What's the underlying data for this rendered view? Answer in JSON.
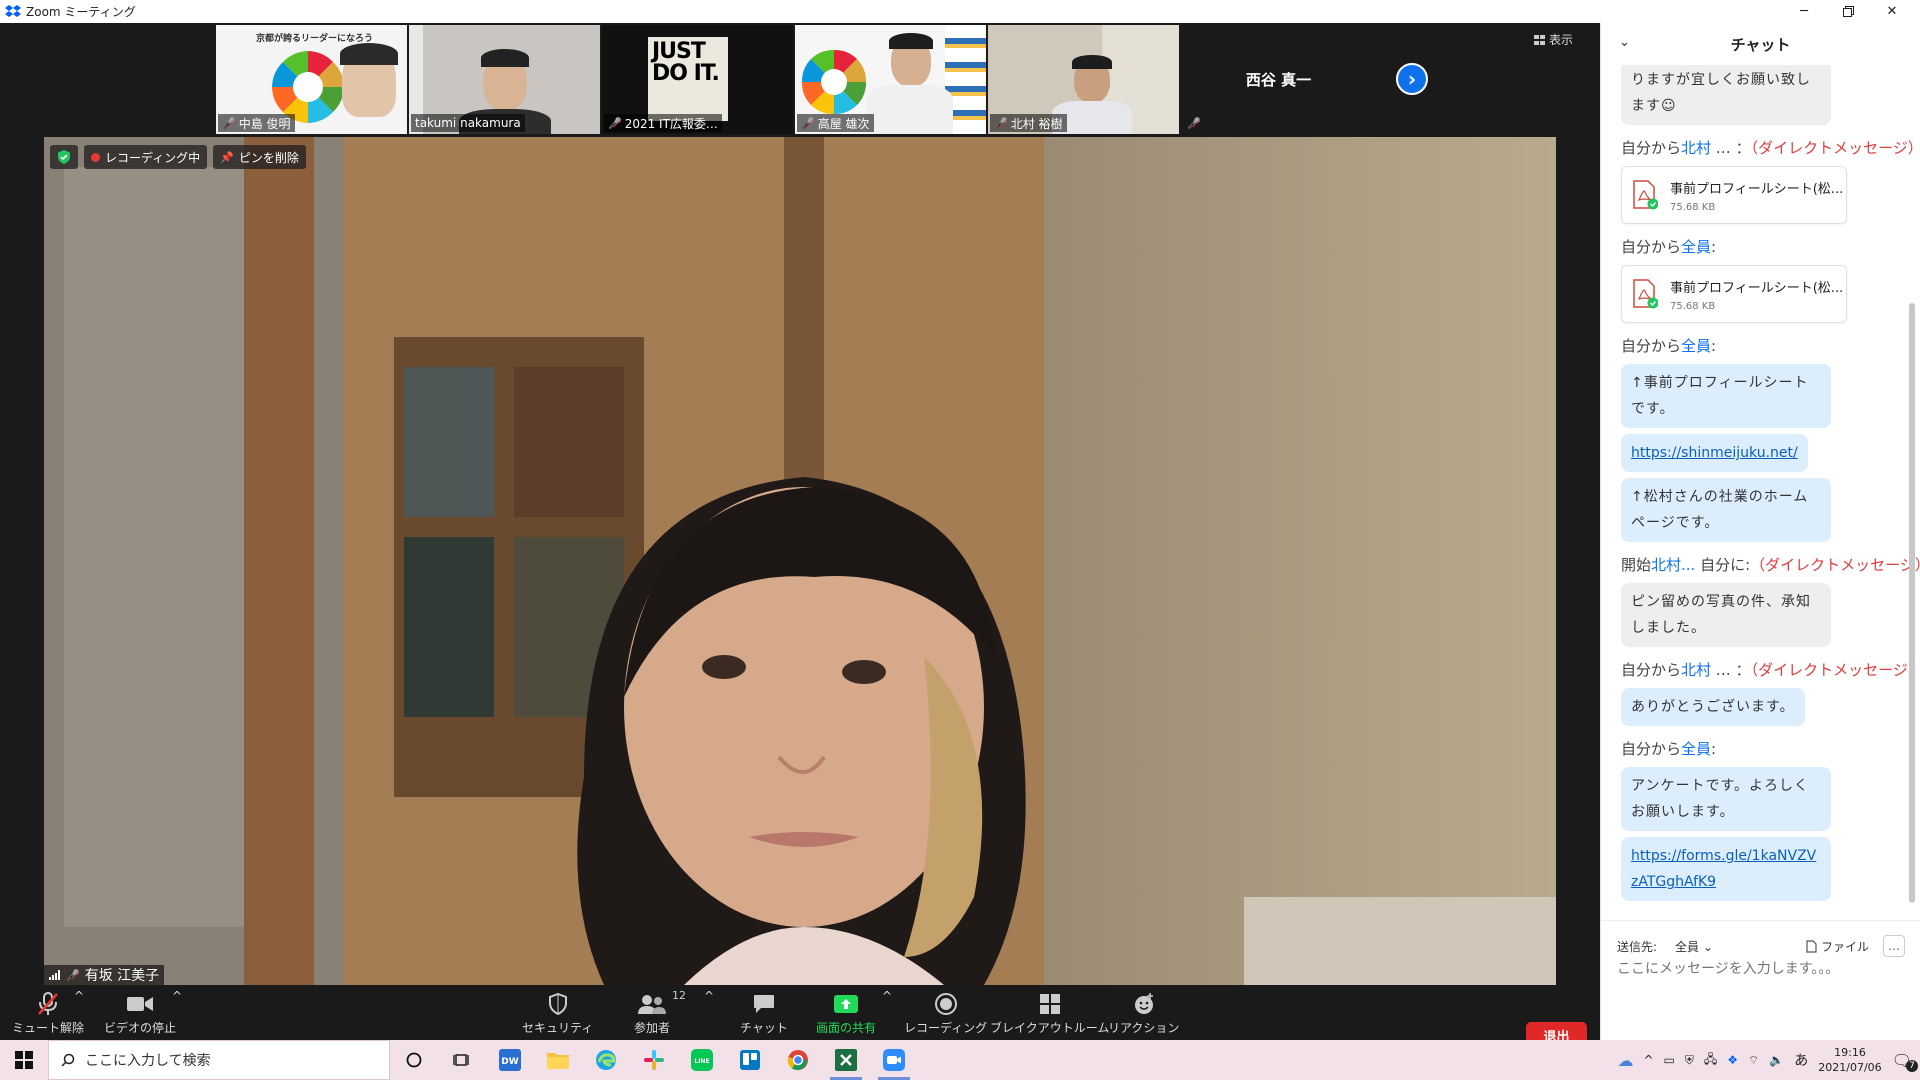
{
  "window": {
    "title": "Zoom ミーティング",
    "controls": [
      "minimize",
      "restore",
      "close"
    ]
  },
  "strip": {
    "participants": [
      {
        "name": "中島 俊明",
        "muted": true,
        "slide_title": "京都が誇るリーダーになろう"
      },
      {
        "name": "takumi nakamura",
        "muted": false
      },
      {
        "name": "2021 IT広報委…",
        "muted": true,
        "poster_text": "JUST DO IT."
      },
      {
        "name": "高屋 雄次",
        "muted": true
      },
      {
        "name": "北村 裕樹",
        "muted": true
      }
    ],
    "no_video_name": "西谷 真一",
    "view_label": "表示"
  },
  "main_video": {
    "recording_label": "レコーディング中",
    "unpin_label": "ピンを削除",
    "speaker_name": "有坂 江美子"
  },
  "toolbar": {
    "unmute": "ミュート解除",
    "stop_video": "ビデオの停止",
    "security": "セキュリティ",
    "participants": "参加者",
    "participants_count": "12",
    "chat": "チャット",
    "share": "画面の共有",
    "record": "レコーディング",
    "breakout": "ブレイクアウトルーム",
    "reactions": "リアクション",
    "leave": "退出",
    "share_color": "#23d959",
    "leave_color": "#e02828"
  },
  "chat": {
    "title": "チャット",
    "partial_top": "りますが宜しくお願い致します☺",
    "m1": {
      "from": "自分から",
      "who": "北村",
      "rest": " … ：",
      "dm": "（ダイレクトメッセージ）"
    },
    "file1": {
      "name": "事前プロフィールシート(松...",
      "size": "75.68 KB"
    },
    "m2": {
      "from": "自分から",
      "who": "全員",
      "rest": ":"
    },
    "file2": {
      "name": "事前プロフィールシート(松...",
      "size": "75.68 KB"
    },
    "m3": {
      "from": "自分から",
      "who": "全員",
      "rest": ":"
    },
    "m3_text": "↑事前プロフィールシートです。",
    "m3_link": "https://shinmeijuku.net/",
    "m3_text2": "↑松村さんの社業のホームページです。",
    "m4": {
      "from": "開始",
      "who": "北村...",
      "rest": " 自分に:",
      "dm": "（ダイレクトメッセージ）"
    },
    "m4_text": "ピン留めの写真の件、承知しました。",
    "m5": {
      "from": "自分から",
      "who": "北村",
      "rest": " … ：",
      "dm": "（ダイレクトメッセージ）"
    },
    "m5_text": "ありがとうございます。",
    "m6": {
      "from": "自分から",
      "who": "全員",
      "rest": ":"
    },
    "m6_text": "アンケートです。よろしくお願いします。",
    "m6_link": "https://forms.gle/1kaNVZVzATGghAfK9",
    "send_to_label": "送信先:",
    "send_to_value": "全員",
    "file_label": "ファイル",
    "more_label": "…",
    "input_placeholder": "ここにメッセージを入力します。。。",
    "accent": "#0e72ed",
    "dm_color": "#e03c3c"
  },
  "taskbar": {
    "search_placeholder": "ここに入力して検索",
    "time": "19:16",
    "date": "2021/07/06",
    "ime": "あ",
    "notification_count": "7",
    "apps": [
      "task-view",
      "dreamweaver",
      "explorer",
      "edge",
      "slack",
      "line",
      "trello",
      "chrome",
      "excel",
      "zoom"
    ]
  }
}
